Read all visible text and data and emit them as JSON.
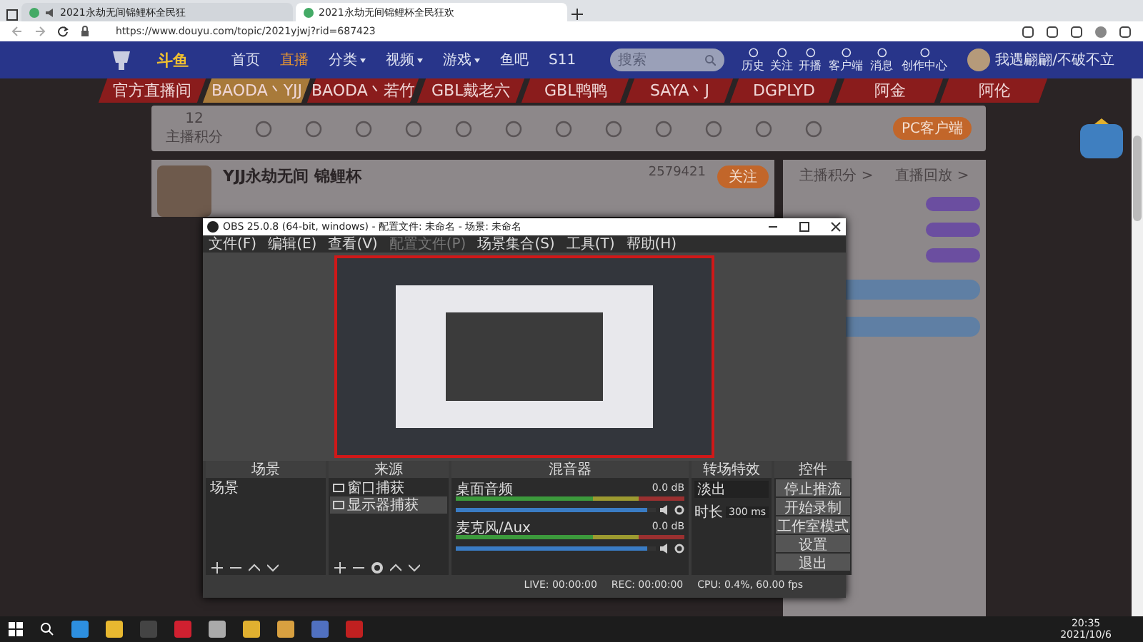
{
  "browser": {
    "tabs": [
      {
        "title": "2021永劫无间锦鲤杯全民狂",
        "muted": true,
        "selected": false
      },
      {
        "title": "2021永劫无间锦鲤杯全民狂欢",
        "muted": false,
        "selected": true
      }
    ],
    "url": "https://www.douyu.com/topic/2021yjwj?rid=687423"
  },
  "site_header": {
    "logo": "斗鱼",
    "nav": [
      {
        "label": "首页",
        "dropdown": false,
        "selected": false
      },
      {
        "label": "直播",
        "dropdown": false,
        "selected": true
      },
      {
        "label": "分类",
        "dropdown": true,
        "selected": false
      },
      {
        "label": "视频",
        "dropdown": true,
        "selected": false
      },
      {
        "label": "游戏",
        "dropdown": true,
        "selected": false
      },
      {
        "label": "鱼吧",
        "dropdown": false,
        "selected": false
      },
      {
        "label": "S11",
        "dropdown": false,
        "selected": false
      }
    ],
    "search": {
      "placeholder": "搜索"
    },
    "actions": [
      "历史",
      "关注",
      "开播",
      "客户端",
      "消息",
      "创作中心"
    ],
    "username": "我遇翩翩/不破不立"
  },
  "streamer_tabs": [
    {
      "label": "官方直播间",
      "selected": false
    },
    {
      "label": "BAODA丶YJJ",
      "selected": true
    },
    {
      "label": "BAODA丶若竹",
      "selected": false
    },
    {
      "label": "GBL戴老六",
      "selected": false
    },
    {
      "label": "GBL鸭鸭",
      "selected": false
    },
    {
      "label": "SAYA丶J",
      "selected": false
    },
    {
      "label": "DGPLYD",
      "selected": false
    },
    {
      "label": "阿金",
      "selected": false
    },
    {
      "label": "阿伦",
      "selected": false
    }
  ],
  "toolbar": {
    "score": "12",
    "score_label": "主播积分",
    "client_button": "PC客户端"
  },
  "streamer_card": {
    "name": "YJJ永劫无间 锦鲤杯",
    "follow_count": "2579421",
    "follow_button": "关注"
  },
  "rank_panel": {
    "links": [
      "主播积分 >",
      "直播回放 >"
    ]
  },
  "obs": {
    "title": "OBS 25.0.8 (64-bit, windows) - 配置文件: 未命名 - 场景: 未命名",
    "menu": [
      {
        "label": "文件(F)",
        "disabled": false
      },
      {
        "label": "编辑(E)",
        "disabled": false
      },
      {
        "label": "查看(V)",
        "disabled": false
      },
      {
        "label": "配置文件(P)",
        "disabled": true
      },
      {
        "label": "场景集合(S)",
        "disabled": false
      },
      {
        "label": "工具(T)",
        "disabled": false
      },
      {
        "label": "帮助(H)",
        "disabled": false
      }
    ],
    "docks": {
      "scenes": "场景",
      "sources": "来源",
      "mixer": "混音器",
      "transitions": "转场特效",
      "controls": "控件"
    },
    "scenes": [
      {
        "name": "场景",
        "selected": false
      }
    ],
    "sources": [
      {
        "name": "窗口捕获",
        "selected": false
      },
      {
        "name": "显示器捕获",
        "selected": true
      }
    ],
    "mixer": [
      {
        "name": "桌面音频",
        "reading": "0.0 dB",
        "level": 0.96
      },
      {
        "name": "麦克风/Aux",
        "reading": "0.0 dB",
        "level": 0.96
      }
    ],
    "transition": {
      "value": "淡出",
      "duration_label": "时长",
      "duration": "300 ms"
    },
    "controls": [
      "停止推流",
      "开始录制",
      "工作室模式",
      "设置",
      "退出"
    ],
    "status": {
      "live": "LIVE: 00:00:00",
      "rec": "REC: 00:00:00",
      "cpu": "CPU: 0.4%, 60.00 fps"
    }
  },
  "taskbar": {
    "time": "20:35",
    "date": "2021/10/6"
  }
}
